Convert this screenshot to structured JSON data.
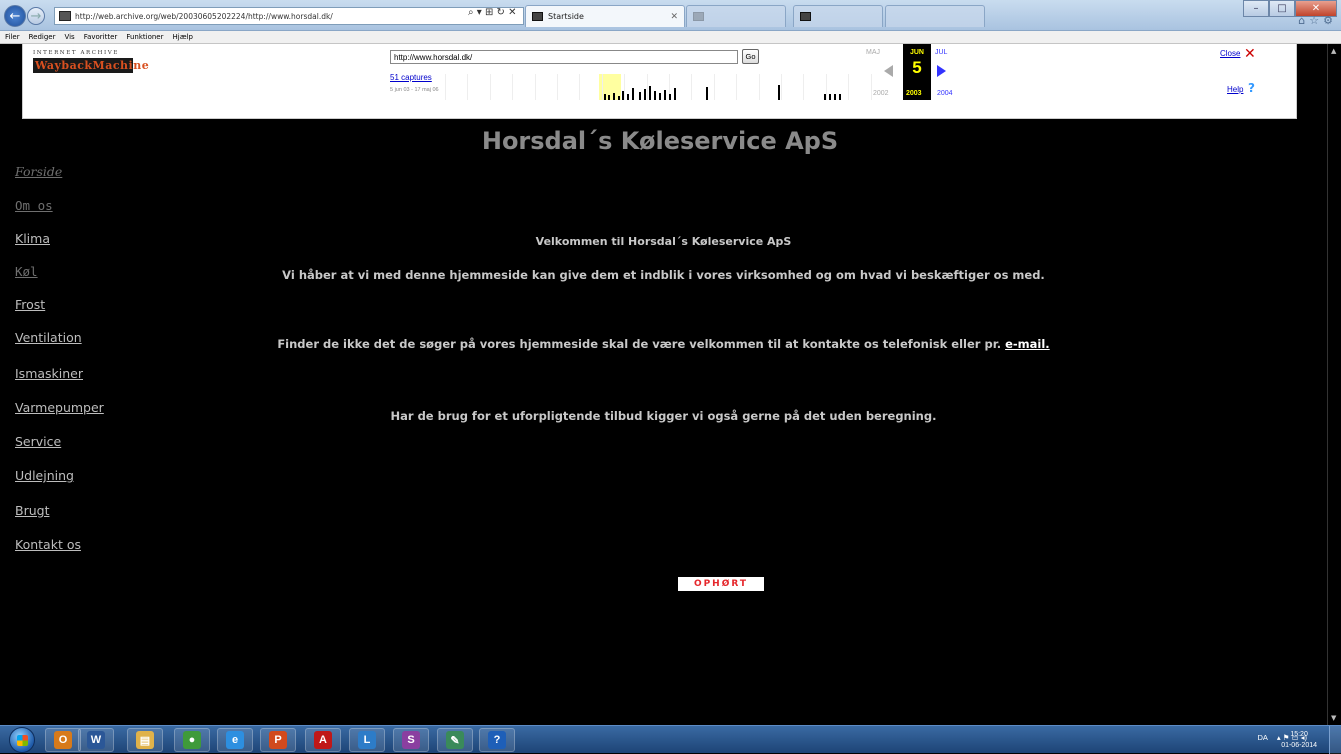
{
  "browser": {
    "address": "http://web.archive.org/web/20030605202224/http://www.horsdal.dk/",
    "address_tools": "⌕ ▾ ⊞ ↻ ✕",
    "active_tab": "Startside",
    "menu": [
      "Filer",
      "Rediger",
      "Vis",
      "Favoritter",
      "Funktioner",
      "Hjælp"
    ],
    "window_controls": [
      "–",
      "□",
      "✕"
    ],
    "fav_icons": [
      "⌂",
      "☆",
      "⚙"
    ]
  },
  "wayback": {
    "logo_top": "INTERNET ARCHIVE",
    "logo_main": "WaybackMachine",
    "url": "http://www.horsdal.dk/",
    "go": "Go",
    "captures": "51 captures",
    "range": "5 jun 03 - 17 maj 06",
    "prev_month": "MAJ",
    "cur_month": "JUN",
    "next_month": "JUL",
    "day": "5",
    "prev_year": "2002",
    "cur_year": "2003",
    "next_year": "2004",
    "close": "Close",
    "help": "Help"
  },
  "page": {
    "title": "Horsdal´s Køleservice ApS",
    "nav": [
      "Forside",
      "Om os",
      "Klima",
      "Køl",
      "Frost",
      "Ventilation",
      "Ismaskiner",
      "Varmepumper",
      "Service",
      "Udlejning",
      "Brugt",
      "Kontakt os"
    ],
    "welcome": "Velkommen til Horsdal´s Køleservice ApS",
    "intro": "Vi håber at vi med denne hjemmeside kan give dem et indblik i vores virksomhed og om hvad vi beskæftiger os med.",
    "contact_prefix": "Finder de ikke det de søger på vores hjemmeside skal de være velkommen til at kontakte os telefonisk eller pr.",
    "email_link": "e-mail.",
    "offer": "Har de brug for et uforpligtende tilbud kigger vi også gerne på det uden beregning.",
    "stamp": "OPHØRT"
  },
  "taskbar": {
    "apps": [
      {
        "name": "outlook",
        "glyph": "O",
        "color": "#d87a1a"
      },
      {
        "name": "word",
        "glyph": "W",
        "color": "#2b5797"
      },
      {
        "name": "explorer",
        "glyph": "▤",
        "color": "#e0b24a"
      },
      {
        "name": "chrome",
        "glyph": "●",
        "color": "#3f9a3a"
      },
      {
        "name": "ie",
        "glyph": "e",
        "color": "#2d8fe0"
      },
      {
        "name": "powerpoint",
        "glyph": "P",
        "color": "#d14a1d"
      },
      {
        "name": "acrobat",
        "glyph": "A",
        "color": "#c01818"
      },
      {
        "name": "lync",
        "glyph": "L",
        "color": "#2d7cc8"
      },
      {
        "name": "sway",
        "glyph": "S",
        "color": "#8a3fa0"
      },
      {
        "name": "paint",
        "glyph": "✎",
        "color": "#3a8a5a"
      },
      {
        "name": "help",
        "glyph": "?",
        "color": "#1e5fb8"
      }
    ],
    "tray_lang": "DA",
    "tray_icons": "▴ ⚑ ▭ ◂)",
    "time": "15:20",
    "date": "01-06-2014"
  }
}
